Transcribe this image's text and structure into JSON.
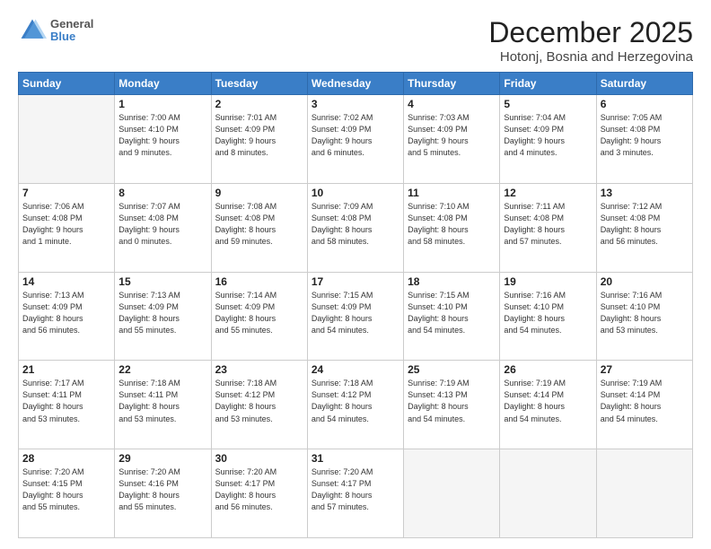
{
  "header": {
    "logo_general": "General",
    "logo_blue": "Blue",
    "month_title": "December 2025",
    "location": "Hotonj, Bosnia and Herzegovina"
  },
  "weekdays": [
    "Sunday",
    "Monday",
    "Tuesday",
    "Wednesday",
    "Thursday",
    "Friday",
    "Saturday"
  ],
  "weeks": [
    [
      {
        "day": "",
        "info": ""
      },
      {
        "day": "1",
        "info": "Sunrise: 7:00 AM\nSunset: 4:10 PM\nDaylight: 9 hours\nand 9 minutes."
      },
      {
        "day": "2",
        "info": "Sunrise: 7:01 AM\nSunset: 4:09 PM\nDaylight: 9 hours\nand 8 minutes."
      },
      {
        "day": "3",
        "info": "Sunrise: 7:02 AM\nSunset: 4:09 PM\nDaylight: 9 hours\nand 6 minutes."
      },
      {
        "day": "4",
        "info": "Sunrise: 7:03 AM\nSunset: 4:09 PM\nDaylight: 9 hours\nand 5 minutes."
      },
      {
        "day": "5",
        "info": "Sunrise: 7:04 AM\nSunset: 4:09 PM\nDaylight: 9 hours\nand 4 minutes."
      },
      {
        "day": "6",
        "info": "Sunrise: 7:05 AM\nSunset: 4:08 PM\nDaylight: 9 hours\nand 3 minutes."
      }
    ],
    [
      {
        "day": "7",
        "info": "Sunrise: 7:06 AM\nSunset: 4:08 PM\nDaylight: 9 hours\nand 1 minute."
      },
      {
        "day": "8",
        "info": "Sunrise: 7:07 AM\nSunset: 4:08 PM\nDaylight: 9 hours\nand 0 minutes."
      },
      {
        "day": "9",
        "info": "Sunrise: 7:08 AM\nSunset: 4:08 PM\nDaylight: 8 hours\nand 59 minutes."
      },
      {
        "day": "10",
        "info": "Sunrise: 7:09 AM\nSunset: 4:08 PM\nDaylight: 8 hours\nand 58 minutes."
      },
      {
        "day": "11",
        "info": "Sunrise: 7:10 AM\nSunset: 4:08 PM\nDaylight: 8 hours\nand 58 minutes."
      },
      {
        "day": "12",
        "info": "Sunrise: 7:11 AM\nSunset: 4:08 PM\nDaylight: 8 hours\nand 57 minutes."
      },
      {
        "day": "13",
        "info": "Sunrise: 7:12 AM\nSunset: 4:08 PM\nDaylight: 8 hours\nand 56 minutes."
      }
    ],
    [
      {
        "day": "14",
        "info": "Sunrise: 7:13 AM\nSunset: 4:09 PM\nDaylight: 8 hours\nand 56 minutes."
      },
      {
        "day": "15",
        "info": "Sunrise: 7:13 AM\nSunset: 4:09 PM\nDaylight: 8 hours\nand 55 minutes."
      },
      {
        "day": "16",
        "info": "Sunrise: 7:14 AM\nSunset: 4:09 PM\nDaylight: 8 hours\nand 55 minutes."
      },
      {
        "day": "17",
        "info": "Sunrise: 7:15 AM\nSunset: 4:09 PM\nDaylight: 8 hours\nand 54 minutes."
      },
      {
        "day": "18",
        "info": "Sunrise: 7:15 AM\nSunset: 4:10 PM\nDaylight: 8 hours\nand 54 minutes."
      },
      {
        "day": "19",
        "info": "Sunrise: 7:16 AM\nSunset: 4:10 PM\nDaylight: 8 hours\nand 54 minutes."
      },
      {
        "day": "20",
        "info": "Sunrise: 7:16 AM\nSunset: 4:10 PM\nDaylight: 8 hours\nand 53 minutes."
      }
    ],
    [
      {
        "day": "21",
        "info": "Sunrise: 7:17 AM\nSunset: 4:11 PM\nDaylight: 8 hours\nand 53 minutes."
      },
      {
        "day": "22",
        "info": "Sunrise: 7:18 AM\nSunset: 4:11 PM\nDaylight: 8 hours\nand 53 minutes."
      },
      {
        "day": "23",
        "info": "Sunrise: 7:18 AM\nSunset: 4:12 PM\nDaylight: 8 hours\nand 53 minutes."
      },
      {
        "day": "24",
        "info": "Sunrise: 7:18 AM\nSunset: 4:12 PM\nDaylight: 8 hours\nand 54 minutes."
      },
      {
        "day": "25",
        "info": "Sunrise: 7:19 AM\nSunset: 4:13 PM\nDaylight: 8 hours\nand 54 minutes."
      },
      {
        "day": "26",
        "info": "Sunrise: 7:19 AM\nSunset: 4:14 PM\nDaylight: 8 hours\nand 54 minutes."
      },
      {
        "day": "27",
        "info": "Sunrise: 7:19 AM\nSunset: 4:14 PM\nDaylight: 8 hours\nand 54 minutes."
      }
    ],
    [
      {
        "day": "28",
        "info": "Sunrise: 7:20 AM\nSunset: 4:15 PM\nDaylight: 8 hours\nand 55 minutes."
      },
      {
        "day": "29",
        "info": "Sunrise: 7:20 AM\nSunset: 4:16 PM\nDaylight: 8 hours\nand 55 minutes."
      },
      {
        "day": "30",
        "info": "Sunrise: 7:20 AM\nSunset: 4:17 PM\nDaylight: 8 hours\nand 56 minutes."
      },
      {
        "day": "31",
        "info": "Sunrise: 7:20 AM\nSunset: 4:17 PM\nDaylight: 8 hours\nand 57 minutes."
      },
      {
        "day": "",
        "info": ""
      },
      {
        "day": "",
        "info": ""
      },
      {
        "day": "",
        "info": ""
      }
    ]
  ]
}
